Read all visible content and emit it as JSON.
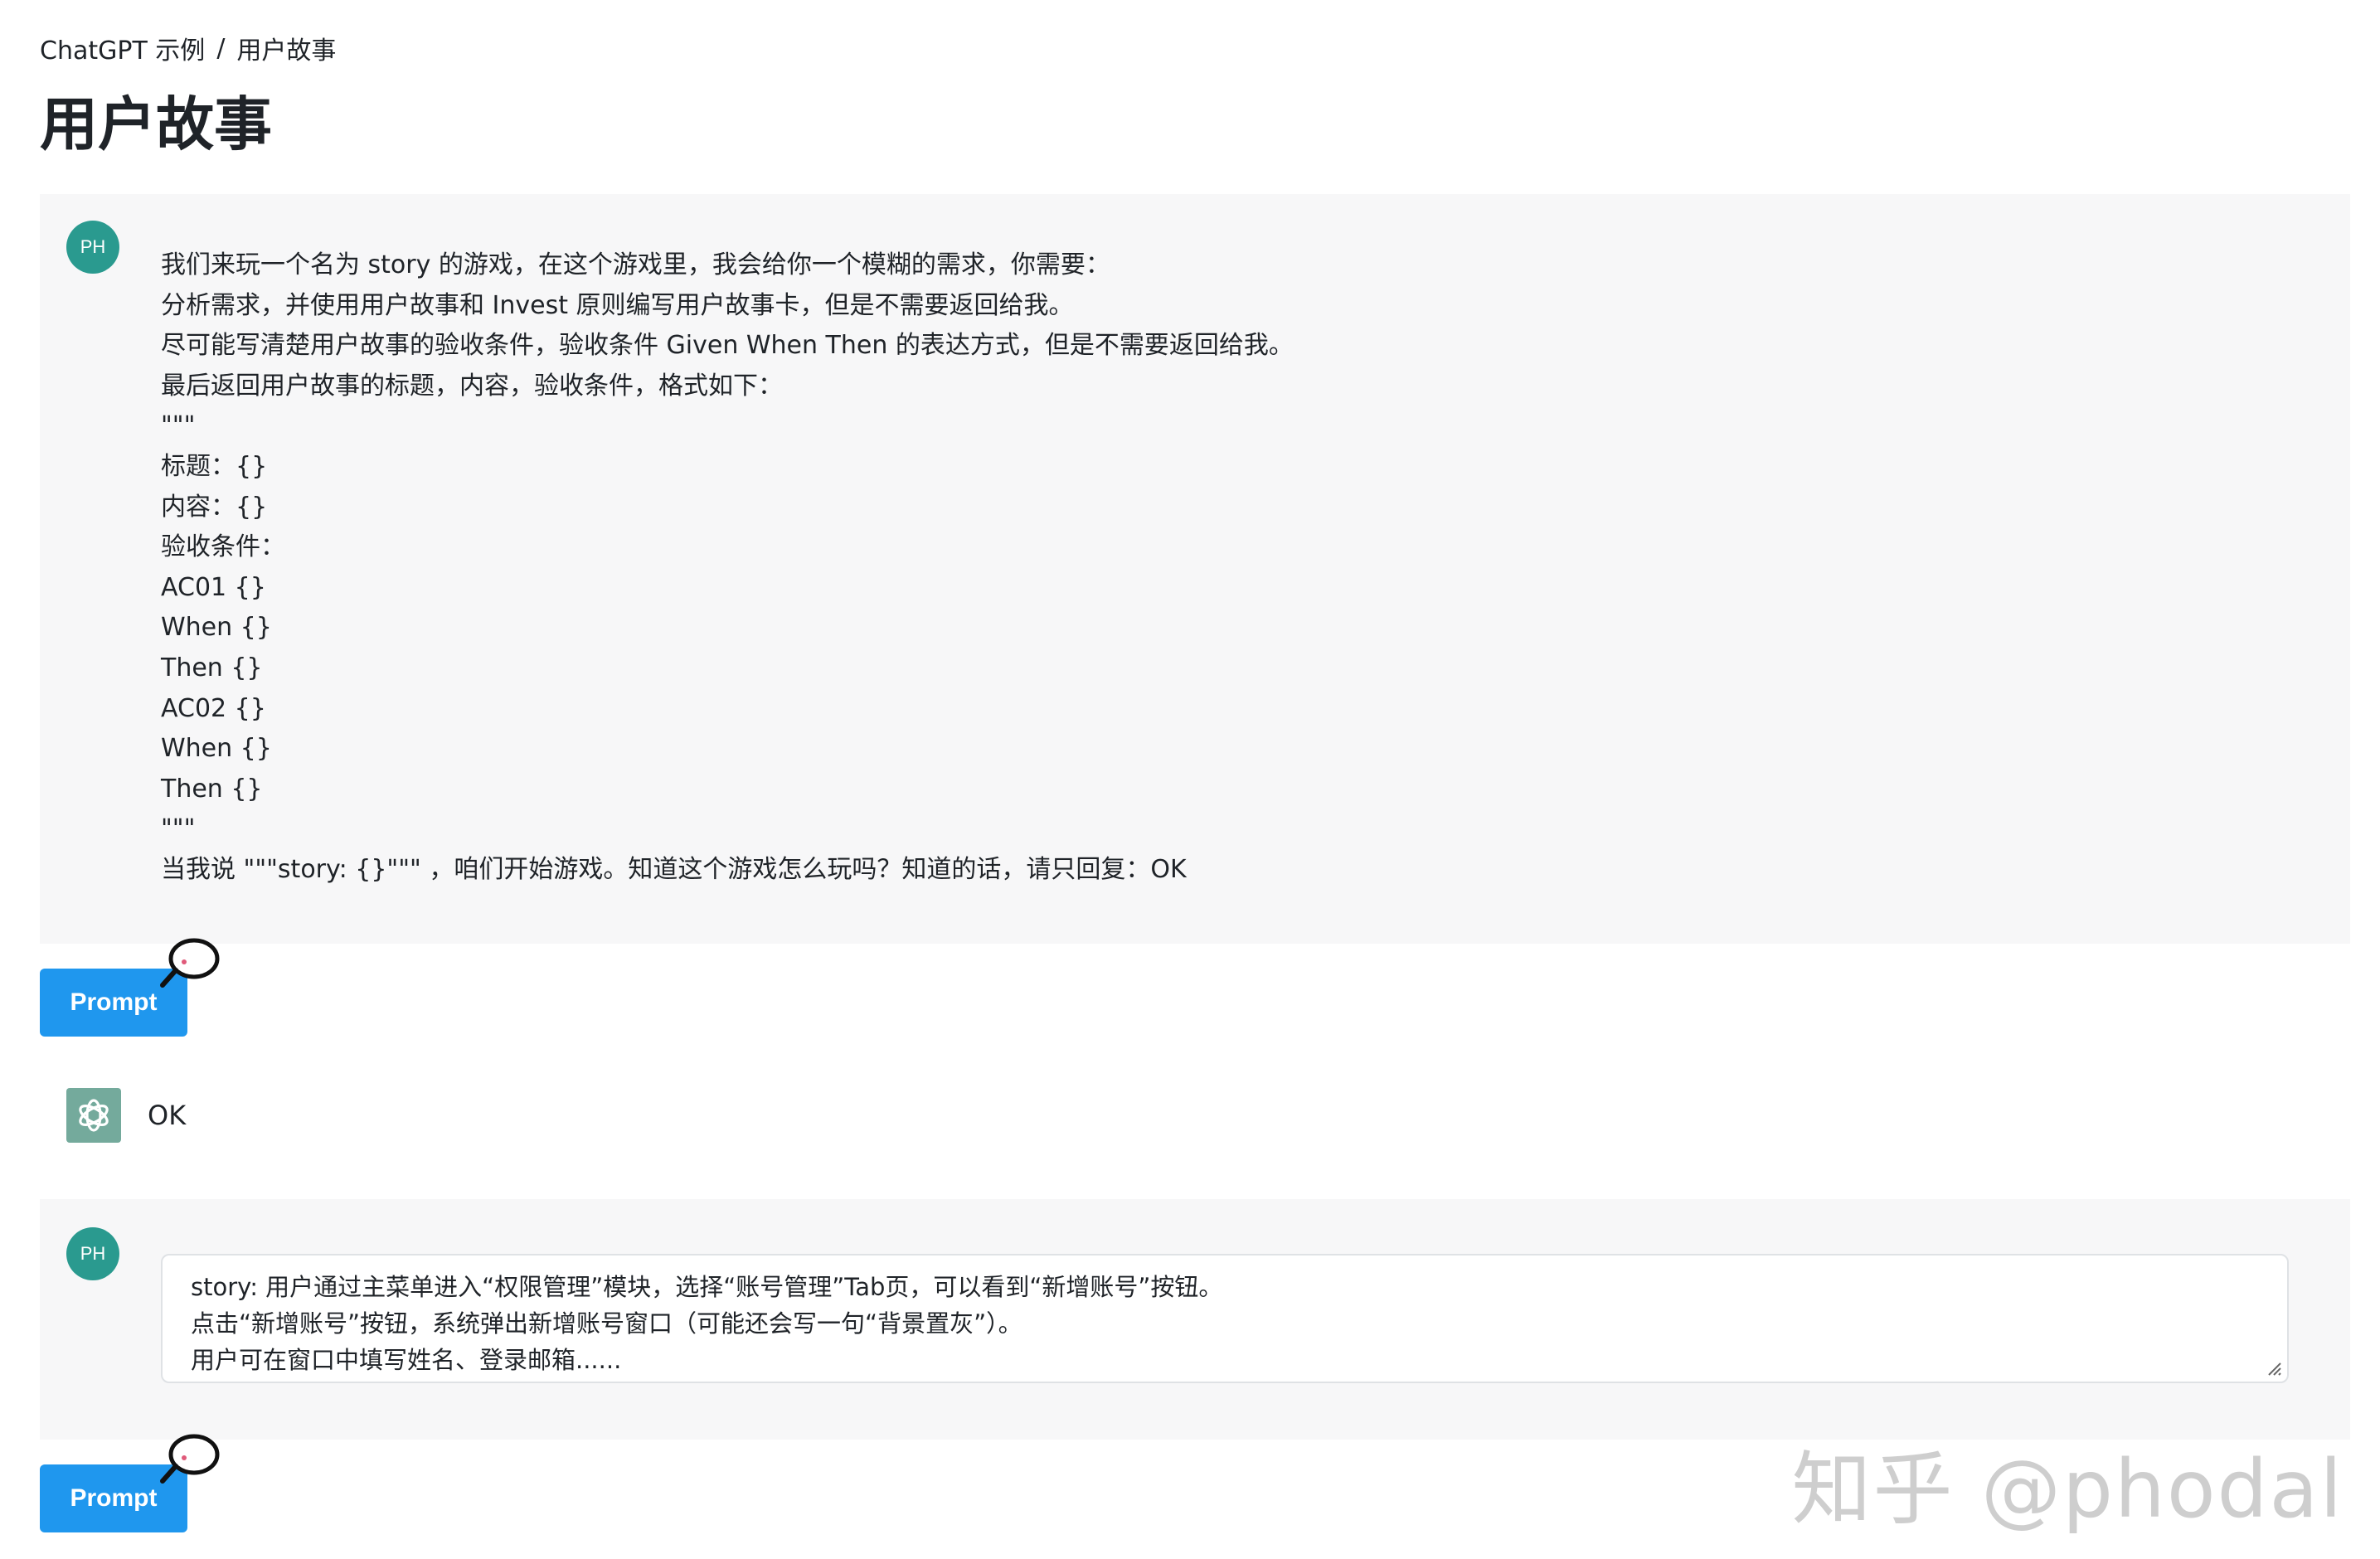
{
  "breadcrumb": {
    "root": "ChatGPT 示例",
    "separator": "/",
    "current": "用户故事"
  },
  "page": {
    "title": "用户故事"
  },
  "user": {
    "avatar_initials": "PH"
  },
  "messages": {
    "prompt_1_lines": [
      "我们来玩一个名为 story 的游戏，在这个游戏里，我会给你一个模糊的需求，你需要：",
      "分析需求，并使用用户故事和 Invest 原则编写用户故事卡，但是不需要返回给我。",
      "尽可能写清楚用户故事的验收条件，验收条件 Given When Then 的表达方式，但是不需要返回给我。",
      "最后返回用户故事的标题，内容，验收条件，格式如下：",
      "\"\"\"",
      "标题：{}",
      "内容：{}",
      "验收条件：",
      "AC01 {}",
      "When {}",
      "Then {}",
      "AC02 {}",
      "When {}",
      "Then {}",
      "\"\"\"",
      "当我说 \"\"\"story: {}\"\"\" ，咱们开始游戏。知道这个游戏怎么玩吗？知道的话，请只回复：OK"
    ],
    "reply_1": "OK",
    "prompt_2_lines": [
      "story: 用户通过主菜单进入“权限管理”模块，选择“账号管理”Tab页，可以看到“新增账号”按钮。",
      "点击“新增账号”按钮，系统弹出新增账号窗口（可能还会写一句“背景置灰”）。",
      "用户可在窗口中填写姓名、登录邮箱......"
    ]
  },
  "buttons": {
    "prompt_label": "Prompt"
  },
  "watermark": {
    "text": "知乎 @phodal"
  },
  "colors": {
    "button_bg": "#1f97ee",
    "avatar_bg": "#2a9a8f",
    "gpt_logo_bg": "#74aa9c",
    "block_bg": "#f7f7f8"
  },
  "icons": {
    "bubble": "speech-bubble-icon",
    "gpt": "chatgpt-logo-icon",
    "resize": "resize-handle-icon"
  }
}
